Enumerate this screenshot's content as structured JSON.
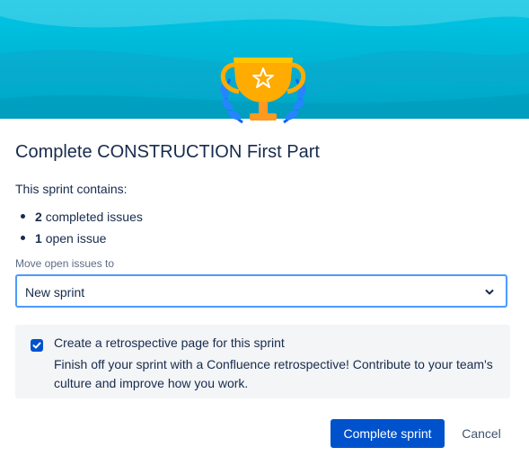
{
  "dialog": {
    "title": "Complete CONSTRUCTION First Part",
    "intro": "This sprint contains:",
    "issues": [
      {
        "count": "2",
        "label": "completed issues"
      },
      {
        "count": "1",
        "label": "open issue"
      }
    ],
    "move_label": "Move open issues to",
    "move_value": "New sprint",
    "retro": {
      "checked": true,
      "title": "Create a retrospective page for this sprint",
      "description": "Finish off your sprint with a Confluence retrospective! Contribute to your team's culture and improve how you work."
    },
    "buttons": {
      "complete": "Complete sprint",
      "cancel": "Cancel"
    }
  },
  "icons": {
    "header": "trophy-icon",
    "select": "chevron-down-icon",
    "checkbox": "checkmark-icon"
  },
  "colors": {
    "header_bg": "#00b8d9",
    "primary": "#0052cc",
    "trophy": "#ffab00",
    "laurel": "#0065ff",
    "panel_bg": "#f4f5f7",
    "focus_border": "#4c9aff"
  }
}
